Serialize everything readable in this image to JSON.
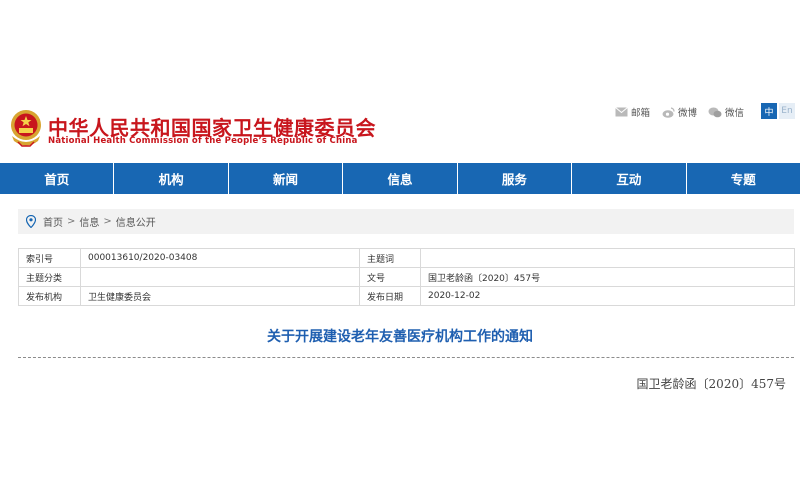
{
  "header": {
    "title_cn": "中华人民共和国国家卫生健康委员会",
    "title_en": "National Health Commission of the People’s Republic of China",
    "links": [
      {
        "label": "邮箱",
        "icon": "mail-icon"
      },
      {
        "label": "微博",
        "icon": "weibo-icon"
      },
      {
        "label": "微信",
        "icon": "wechat-icon"
      }
    ],
    "lang": {
      "zh": "中",
      "en": "En"
    }
  },
  "nav": {
    "items": [
      "首页",
      "机构",
      "新闻",
      "信息",
      "服务",
      "互动",
      "专题"
    ]
  },
  "breadcrumb": {
    "icon": "location-pin-icon",
    "items": [
      "首页",
      "信息",
      "信息公开"
    ],
    "separator": ">"
  },
  "info": {
    "rows": [
      {
        "k1": "索引号",
        "v1": "000013610/2020-03408",
        "k2": "主题词",
        "v2": ""
      },
      {
        "k1": "主题分类",
        "v1": "",
        "k2": "文号",
        "v2": "国卫老龄函〔2020〕457号"
      },
      {
        "k1": "发布机构",
        "v1": "卫生健康委员会",
        "k2": "发布日期",
        "v2": "2020-12-02"
      }
    ]
  },
  "document": {
    "title": "关于开展建设老年友善医疗机构工作的通知",
    "number": "国卫老龄函〔2020〕457号"
  },
  "colors": {
    "brand_red": "#c8161d",
    "nav_blue": "#1867b3",
    "title_blue": "#1f5fb0"
  }
}
